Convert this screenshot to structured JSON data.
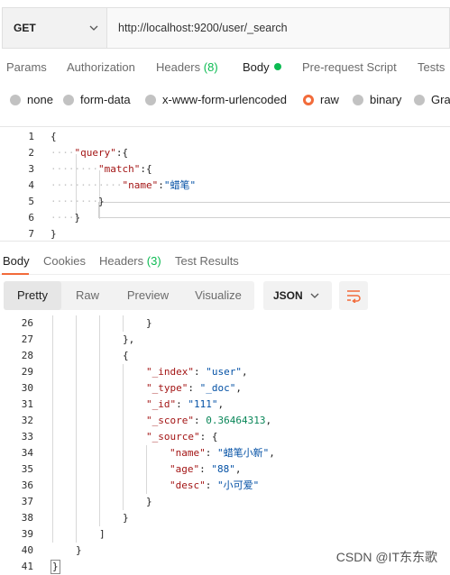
{
  "request": {
    "method": "GET",
    "url": "http://localhost:9200/user/_search"
  },
  "request_tabs": [
    {
      "label": "Params"
    },
    {
      "label": "Authorization"
    },
    {
      "label": "Headers",
      "count": "(8)"
    },
    {
      "label": "Body",
      "active": true
    },
    {
      "label": "Pre-request Script"
    },
    {
      "label": "Tests"
    }
  ],
  "body_types": [
    {
      "label": "none"
    },
    {
      "label": "form-data"
    },
    {
      "label": "x-www-form-urlencoded"
    },
    {
      "label": "raw",
      "selected": true
    },
    {
      "label": "binary"
    },
    {
      "label": "Grap"
    }
  ],
  "request_body_lines": [
    {
      "n": "1",
      "text": "{"
    },
    {
      "n": "2",
      "key": "\"query\"",
      "rest": ":{"
    },
    {
      "n": "3",
      "key": "\"match\"",
      "rest": ":{"
    },
    {
      "n": "4",
      "key": "\"name\"",
      "colon": ":",
      "value": "\"蜡笔\""
    },
    {
      "n": "5",
      "text": "}"
    },
    {
      "n": "6",
      "text": "}"
    },
    {
      "n": "7",
      "text": "}"
    }
  ],
  "response_tabs": [
    {
      "label": "Body",
      "active": true
    },
    {
      "label": "Cookies"
    },
    {
      "label": "Headers",
      "count": "(3)"
    },
    {
      "label": "Test Results"
    }
  ],
  "response_views": [
    "Pretty",
    "Raw",
    "Preview",
    "Visualize"
  ],
  "response_format": "JSON",
  "response_lines": [
    {
      "n": "26",
      "text": "}"
    },
    {
      "n": "27",
      "text": "},"
    },
    {
      "n": "28",
      "text": "{"
    },
    {
      "n": "29",
      "key": "\"_index\"",
      "value": "\"user\"",
      "tail": ","
    },
    {
      "n": "30",
      "key": "\"_type\"",
      "value": "\"_doc\"",
      "tail": ","
    },
    {
      "n": "31",
      "key": "\"_id\"",
      "value": "\"111\"",
      "tail": ","
    },
    {
      "n": "32",
      "key": "\"_score\"",
      "value": "0.36464313",
      "tail": ","
    },
    {
      "n": "33",
      "key": "\"_source\"",
      "value": "{",
      "tail": ""
    },
    {
      "n": "34",
      "key": "\"name\"",
      "value": "\"蜡笔小新\"",
      "tail": ","
    },
    {
      "n": "35",
      "key": "\"age\"",
      "value": "\"88\"",
      "tail": ","
    },
    {
      "n": "36",
      "key": "\"desc\"",
      "value": "\"小可爱\"",
      "tail": ""
    },
    {
      "n": "37",
      "text": "}"
    },
    {
      "n": "38",
      "text": "}"
    },
    {
      "n": "39",
      "text": "]"
    },
    {
      "n": "40",
      "text": "}"
    },
    {
      "n": "41",
      "text": "}"
    }
  ],
  "watermark": "CSDN @IT东东歌",
  "colors": {
    "accent": "#f26b3a",
    "success": "#0cbb52",
    "json_key": "#a31515",
    "json_string": "#0451a5",
    "json_number": "#098658"
  },
  "icons": {
    "method_dropdown": "chevron-down-icon",
    "format_dropdown": "chevron-down-icon",
    "wrap": "wrap-lines-icon"
  }
}
